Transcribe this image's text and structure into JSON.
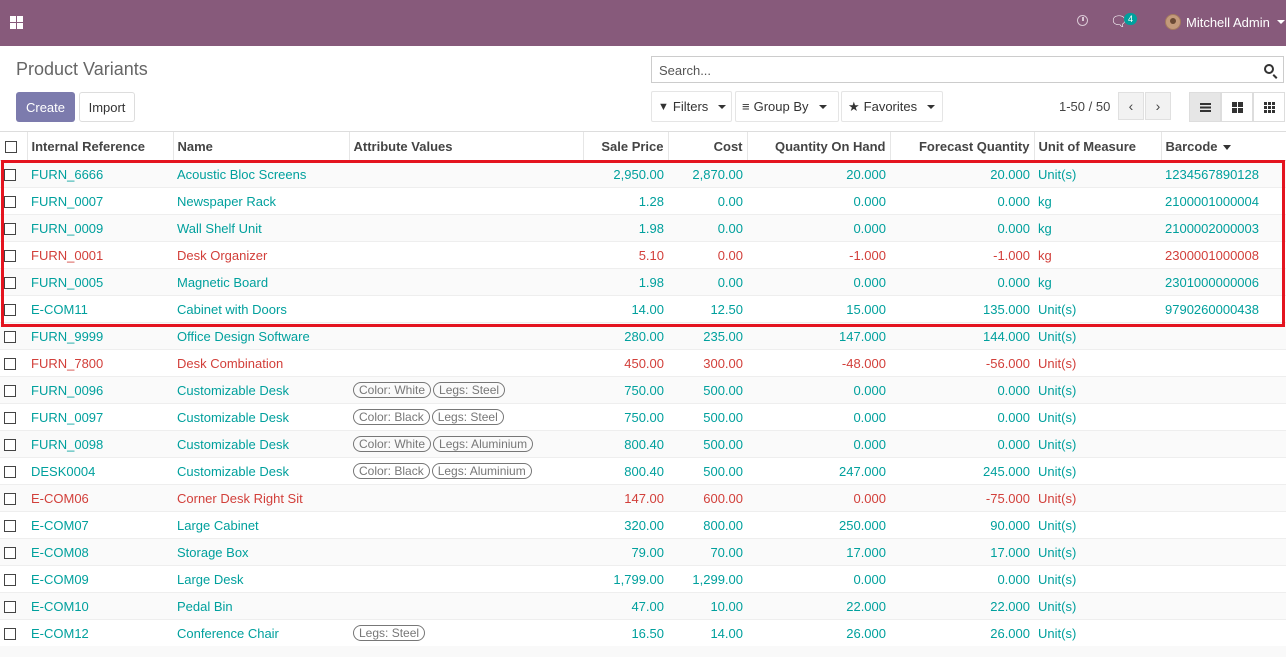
{
  "navbar": {
    "chat_count": "4",
    "user_name": "Mitchell Admin"
  },
  "control": {
    "title": "Product Variants",
    "search_placeholder": "Search...",
    "create_label": "Create",
    "import_label": "Import",
    "filters_label": "Filters",
    "groupby_label": "Group By",
    "favorites_label": "Favorites",
    "pager": "1-50 / 50"
  },
  "table": {
    "columns": [
      "Internal Reference",
      "Name",
      "Attribute Values",
      "Sale Price",
      "Cost",
      "Quantity On Hand",
      "Forecast Quantity",
      "Unit of Measure",
      "Barcode"
    ],
    "rows": [
      {
        "ref": "FURN_6666",
        "name": "Acoustic Bloc Screens",
        "attrs": [],
        "price": "2,950.00",
        "cost": "2,870.00",
        "qty": "20.000",
        "forecast": "20.000",
        "uom": "Unit(s)",
        "barcode": "1234567890128",
        "tone": "teal"
      },
      {
        "ref": "FURN_0007",
        "name": "Newspaper Rack",
        "attrs": [],
        "price": "1.28",
        "cost": "0.00",
        "qty": "0.000",
        "forecast": "0.000",
        "uom": "kg",
        "barcode": "2100001000004",
        "tone": "teal"
      },
      {
        "ref": "FURN_0009",
        "name": "Wall Shelf Unit",
        "attrs": [],
        "price": "1.98",
        "cost": "0.00",
        "qty": "0.000",
        "forecast": "0.000",
        "uom": "kg",
        "barcode": "2100002000003",
        "tone": "teal"
      },
      {
        "ref": "FURN_0001",
        "name": "Desk Organizer",
        "attrs": [],
        "price": "5.10",
        "cost": "0.00",
        "qty": "-1.000",
        "forecast": "-1.000",
        "uom": "kg",
        "barcode": "2300001000008",
        "tone": "red"
      },
      {
        "ref": "FURN_0005",
        "name": "Magnetic Board",
        "attrs": [],
        "price": "1.98",
        "cost": "0.00",
        "qty": "0.000",
        "forecast": "0.000",
        "uom": "kg",
        "barcode": "2301000000006",
        "tone": "teal"
      },
      {
        "ref": "E-COM11",
        "name": "Cabinet with Doors",
        "attrs": [],
        "price": "14.00",
        "cost": "12.50",
        "qty": "15.000",
        "forecast": "135.000",
        "uom": "Unit(s)",
        "barcode": "9790260000438",
        "tone": "teal"
      },
      {
        "ref": "FURN_9999",
        "name": "Office Design Software",
        "attrs": [],
        "price": "280.00",
        "cost": "235.00",
        "qty": "147.000",
        "forecast": "144.000",
        "uom": "Unit(s)",
        "barcode": "",
        "tone": "teal"
      },
      {
        "ref": "FURN_7800",
        "name": "Desk Combination",
        "attrs": [],
        "price": "450.00",
        "cost": "300.00",
        "qty": "-48.000",
        "forecast": "-56.000",
        "uom": "Unit(s)",
        "barcode": "",
        "tone": "red"
      },
      {
        "ref": "FURN_0096",
        "name": "Customizable Desk",
        "attrs": [
          "Color: White",
          "Legs: Steel"
        ],
        "price": "750.00",
        "cost": "500.00",
        "qty": "0.000",
        "forecast": "0.000",
        "uom": "Unit(s)",
        "barcode": "",
        "tone": "teal"
      },
      {
        "ref": "FURN_0097",
        "name": "Customizable Desk",
        "attrs": [
          "Color: Black",
          "Legs: Steel"
        ],
        "price": "750.00",
        "cost": "500.00",
        "qty": "0.000",
        "forecast": "0.000",
        "uom": "Unit(s)",
        "barcode": "",
        "tone": "teal"
      },
      {
        "ref": "FURN_0098",
        "name": "Customizable Desk",
        "attrs": [
          "Color: White",
          "Legs: Aluminium"
        ],
        "price": "800.40",
        "cost": "500.00",
        "qty": "0.000",
        "forecast": "0.000",
        "uom": "Unit(s)",
        "barcode": "",
        "tone": "teal"
      },
      {
        "ref": "DESK0004",
        "name": "Customizable Desk",
        "attrs": [
          "Color: Black",
          "Legs: Aluminium"
        ],
        "price": "800.40",
        "cost": "500.00",
        "qty": "247.000",
        "forecast": "245.000",
        "uom": "Unit(s)",
        "barcode": "",
        "tone": "teal"
      },
      {
        "ref": "E-COM06",
        "name": "Corner Desk Right Sit",
        "attrs": [],
        "price": "147.00",
        "cost": "600.00",
        "qty": "0.000",
        "forecast": "-75.000",
        "uom": "Unit(s)",
        "barcode": "",
        "tone": "red"
      },
      {
        "ref": "E-COM07",
        "name": "Large Cabinet",
        "attrs": [],
        "price": "320.00",
        "cost": "800.00",
        "qty": "250.000",
        "forecast": "90.000",
        "uom": "Unit(s)",
        "barcode": "",
        "tone": "teal"
      },
      {
        "ref": "E-COM08",
        "name": "Storage Box",
        "attrs": [],
        "price": "79.00",
        "cost": "70.00",
        "qty": "17.000",
        "forecast": "17.000",
        "uom": "Unit(s)",
        "barcode": "",
        "tone": "teal"
      },
      {
        "ref": "E-COM09",
        "name": "Large Desk",
        "attrs": [],
        "price": "1,799.00",
        "cost": "1,299.00",
        "qty": "0.000",
        "forecast": "0.000",
        "uom": "Unit(s)",
        "barcode": "",
        "tone": "teal"
      },
      {
        "ref": "E-COM10",
        "name": "Pedal Bin",
        "attrs": [],
        "price": "47.00",
        "cost": "10.00",
        "qty": "22.000",
        "forecast": "22.000",
        "uom": "Unit(s)",
        "barcode": "",
        "tone": "teal"
      },
      {
        "ref": "E-COM12",
        "name": "Conference Chair",
        "attrs": [
          "Legs: Steel"
        ],
        "price": "16.50",
        "cost": "14.00",
        "qty": "26.000",
        "forecast": "26.000",
        "uom": "Unit(s)",
        "barcode": "",
        "tone": "teal"
      }
    ]
  },
  "colors": {
    "navbar": "#875a7b",
    "primary_button": "#7c7bad",
    "teal_text": "#00a09d",
    "red_text": "#d23f3a",
    "highlight_box": "#e4141f"
  }
}
